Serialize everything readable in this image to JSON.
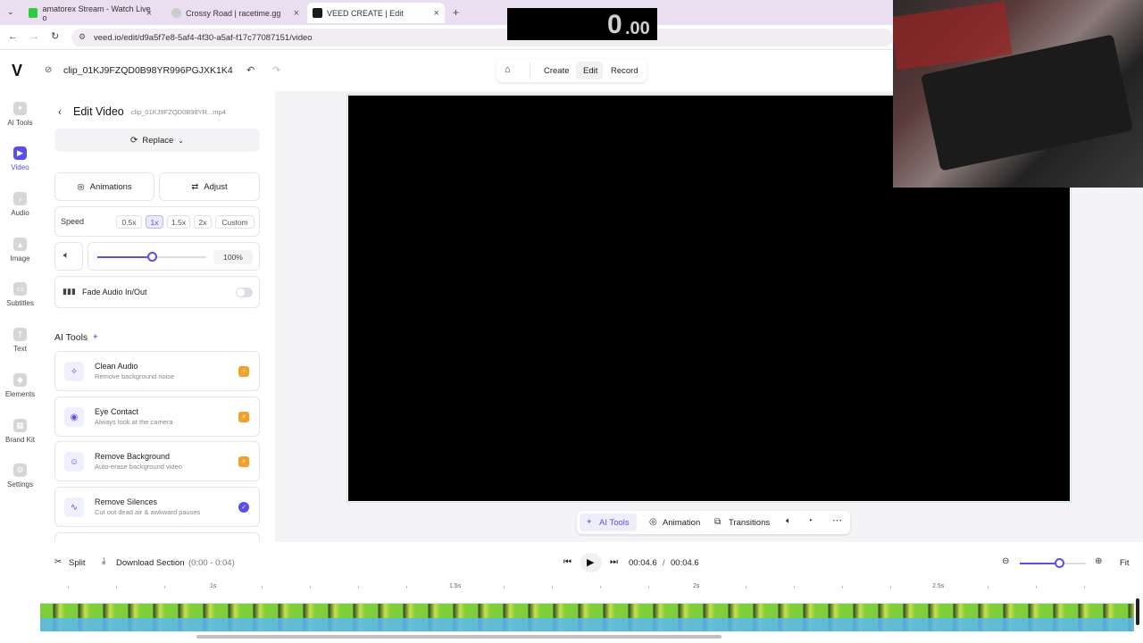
{
  "browser": {
    "tabs": [
      {
        "label": "amatorex Stream - Watch Live o",
        "favicon_color": "#2ecc40"
      },
      {
        "label": "Crossy Road | racetime.gg",
        "favicon_color": "#cccccc"
      },
      {
        "label": "VEED CREATE | Edit",
        "favicon_color": "#1a1a1a"
      }
    ],
    "url": "veed.io/edit/d9a5f7e8-5af4-4f30-a5af-f17c77087151/video"
  },
  "overlay_timer": {
    "big": "0",
    "small": ".00"
  },
  "header": {
    "logo": "V",
    "project_name": "clip_01KJ9FZQD0B98YR996PGJXK1K4",
    "nav": {
      "create": "Create",
      "edit": "Edit",
      "record": "Record"
    }
  },
  "rail": [
    {
      "label": "AI Tools",
      "icon": "sparkle-icon"
    },
    {
      "label": "Video",
      "icon": "video-icon"
    },
    {
      "label": "Audio",
      "icon": "music-icon"
    },
    {
      "label": "Image",
      "icon": "image-icon"
    },
    {
      "label": "Subtitles",
      "icon": "subtitles-icon"
    },
    {
      "label": "Text",
      "icon": "text-icon"
    },
    {
      "label": "Elements",
      "icon": "elements-icon"
    },
    {
      "label": "Brand Kit",
      "icon": "brand-icon"
    },
    {
      "label": "Settings",
      "icon": "gear-icon"
    }
  ],
  "panel": {
    "title": "Edit Video",
    "filename": "clip_01KJ9FZQD0B98YR...mp4",
    "replace": "Replace",
    "animations": "Animations",
    "adjust": "Adjust",
    "speed_label": "Speed",
    "speeds": [
      "0.5x",
      "1x",
      "1.5x",
      "2x",
      "Custom"
    ],
    "selected_speed": "1x",
    "volume": "100%",
    "volume_level": 0.5,
    "fade_label": "Fade Audio In/Out",
    "ai_tools_heading": "AI Tools",
    "tools": [
      {
        "title": "Clean Audio",
        "desc": "Remove background noise",
        "status": "premium"
      },
      {
        "title": "Eye Contact",
        "desc": "Always look at the camera",
        "status": "premium"
      },
      {
        "title": "Remove Background",
        "desc": "Auto-erase background video",
        "status": "premium"
      },
      {
        "title": "Remove Silences",
        "desc": "Cut out dead air & awkward pauses",
        "status": "applied"
      }
    ]
  },
  "canvas_toolbar": {
    "ai_tools": "AI Tools",
    "animation": "Animation",
    "transitions": "Transitions"
  },
  "timeline": {
    "split": "Split",
    "download": "Download Section",
    "range": "(0:00 - 0:04)",
    "current": "00:04.6",
    "separator": "/",
    "total": "00:04.6",
    "fit": "Fit",
    "zoom_level": 0.6,
    "ruler": [
      "1s",
      "1.5s",
      "2s",
      "2.5s"
    ]
  }
}
